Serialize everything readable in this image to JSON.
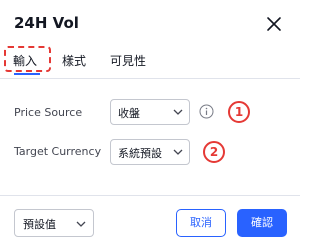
{
  "dialog": {
    "title": "24H Vol",
    "close_icon": "close-icon"
  },
  "tabs": [
    {
      "label": "輸入",
      "active": true
    },
    {
      "label": "樣式",
      "active": false
    },
    {
      "label": "可見性",
      "active": false
    }
  ],
  "inputs": {
    "price_source": {
      "label": "Price Source",
      "value": "收盤",
      "info_icon": "info-icon"
    },
    "target_currency": {
      "label": "Target Currency",
      "value": "系統預設"
    }
  },
  "annotations": {
    "marker1": "1",
    "marker2": "2"
  },
  "footer": {
    "defaults_label": "預設值",
    "cancel_label": "取消",
    "ok_label": "確認"
  },
  "colors": {
    "accent": "#2962ff",
    "annotation": "#e53935",
    "border": "#c4c7cf",
    "divider": "#e0e3eb"
  }
}
